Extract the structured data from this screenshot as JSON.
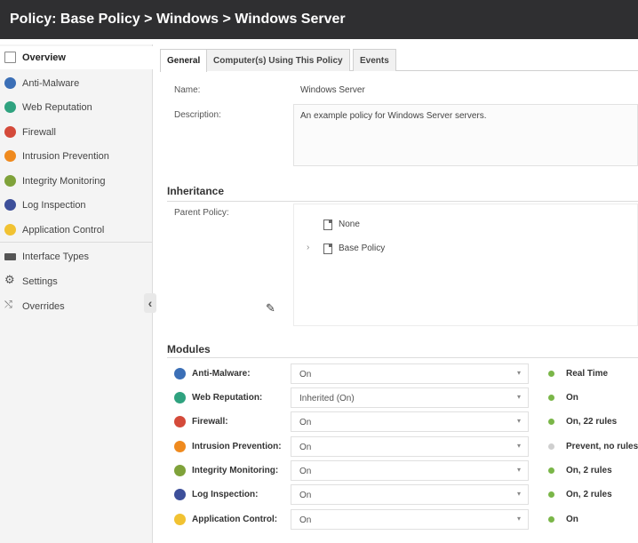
{
  "title": "Policy: Base Policy > Windows > Windows Server",
  "colors": {
    "titlebar": "#2f2f31",
    "status_on": "#7ab648",
    "status_off": "#cfcfcf"
  },
  "sidebar": {
    "items": [
      {
        "label": "Overview",
        "icon": "overview-page-icon",
        "color": "#888888"
      },
      {
        "label": "Anti-Malware",
        "icon": "anti-malware-icon",
        "color": "#3b6fb6"
      },
      {
        "label": "Web Reputation",
        "icon": "web-reputation-icon",
        "color": "#2fa27f"
      },
      {
        "label": "Firewall",
        "icon": "firewall-icon",
        "color": "#d44a3a"
      },
      {
        "label": "Intrusion Prevention",
        "icon": "intrusion-prevention-icon",
        "color": "#ef8a1e"
      },
      {
        "label": "Integrity Monitoring",
        "icon": "integrity-monitoring-icon",
        "color": "#7fa23a"
      },
      {
        "label": "Log Inspection",
        "icon": "log-inspection-icon",
        "color": "#3d4f9a"
      },
      {
        "label": "Application Control",
        "icon": "application-control-icon",
        "color": "#f1c232"
      },
      {
        "label": "Interface Types",
        "icon": "interface-types-icon",
        "color": "#555555"
      },
      {
        "label": "Settings",
        "icon": "settings-gear-icon",
        "color": "#555555"
      },
      {
        "label": "Overrides",
        "icon": "overrides-icon",
        "color": "#777777"
      }
    ]
  },
  "tabs": [
    {
      "label": "General",
      "active": true
    },
    {
      "label": "Computer(s) Using This Policy",
      "active": false
    },
    {
      "label": "Events",
      "active": false
    }
  ],
  "general": {
    "name_label": "Name:",
    "name_value": "Windows Server",
    "description_label": "Description:",
    "description_value": "An example policy for Windows Server servers."
  },
  "inheritance": {
    "title": "Inheritance",
    "parent_label": "Parent Policy:",
    "options": [
      "None",
      "Base Policy"
    ]
  },
  "modules": {
    "title": "Modules",
    "rows": [
      {
        "label": "Anti-Malware:",
        "value": "On",
        "status": "Real Time",
        "status_on": true,
        "icon": "anti-malware-icon",
        "color": "#3b6fb6"
      },
      {
        "label": "Web Reputation:",
        "value": "Inherited (On)",
        "status": "On",
        "status_on": true,
        "icon": "web-reputation-icon",
        "color": "#2fa27f"
      },
      {
        "label": "Firewall:",
        "value": "On",
        "status": "On, 22 rules",
        "status_on": true,
        "icon": "firewall-icon",
        "color": "#d44a3a"
      },
      {
        "label": "Intrusion Prevention:",
        "value": "On",
        "status": "Prevent, no rules",
        "status_on": false,
        "icon": "intrusion-prevention-icon",
        "color": "#ef8a1e"
      },
      {
        "label": "Integrity Monitoring:",
        "value": "On",
        "status": "On, 2 rules",
        "status_on": true,
        "icon": "integrity-monitoring-icon",
        "color": "#7fa23a"
      },
      {
        "label": "Log Inspection:",
        "value": "On",
        "status": "On, 2 rules",
        "status_on": true,
        "icon": "log-inspection-icon",
        "color": "#3d4f9a"
      },
      {
        "label": "Application Control:",
        "value": "On",
        "status": "On",
        "status_on": true,
        "icon": "application-control-icon",
        "color": "#f1c232"
      }
    ]
  }
}
